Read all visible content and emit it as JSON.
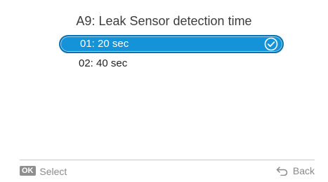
{
  "screen": {
    "title": "A9: Leak Sensor detection time"
  },
  "options": [
    {
      "label": "01: 20 sec",
      "selected": true
    },
    {
      "label": "02: 40 sec",
      "selected": false
    }
  ],
  "footer": {
    "ok_badge": "OK",
    "select_label": "Select",
    "back_label": "Back"
  },
  "icons": {
    "check": "check-circle-icon",
    "back": "back-arrow-icon"
  },
  "colors": {
    "selected_fill": "#1593d8",
    "selected_border": "#0b6fb0",
    "footer_text": "#8a8a8a"
  }
}
